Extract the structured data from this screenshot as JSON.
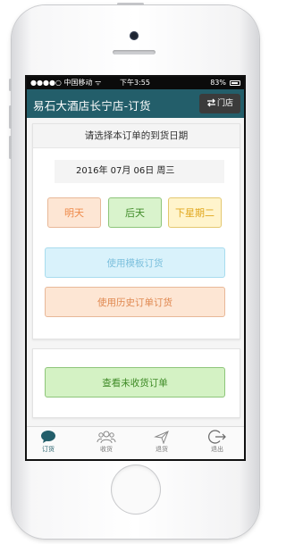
{
  "status_bar": {
    "carrier": "●●●●○ 中国移动 ᯤ",
    "time": "下午3:55",
    "battery": "83%"
  },
  "header": {
    "title": "易石大酒店长宁店-订货",
    "store_button": "门店",
    "store_icon": "swap-arrows-icon"
  },
  "order_card": {
    "heading": "请选择本订单的到货日期",
    "selected_date": "2016年 07月 06日 周三",
    "quick_dates": [
      "明天",
      "后天",
      "下星期二"
    ],
    "template_order_button": "使用模板订货",
    "history_order_button": "使用历史订单订货"
  },
  "pending_card": {
    "unreceived_orders_button": "查看未收货订单"
  },
  "tab_bar": {
    "active_tab": "订货",
    "tabs": [
      {
        "label": "订货",
        "icon": "chat-bubble-icon"
      },
      {
        "label": "收货",
        "icon": "users-icon"
      },
      {
        "label": "退货",
        "icon": "send-icon"
      },
      {
        "label": "退出",
        "icon": "logout-icon"
      }
    ]
  },
  "colors": {
    "navbar": "#235e6a",
    "orange": "#ee8a4a",
    "green": "#3e8a26",
    "yellow": "#e0a71e",
    "blue": "#7cc0dd"
  }
}
